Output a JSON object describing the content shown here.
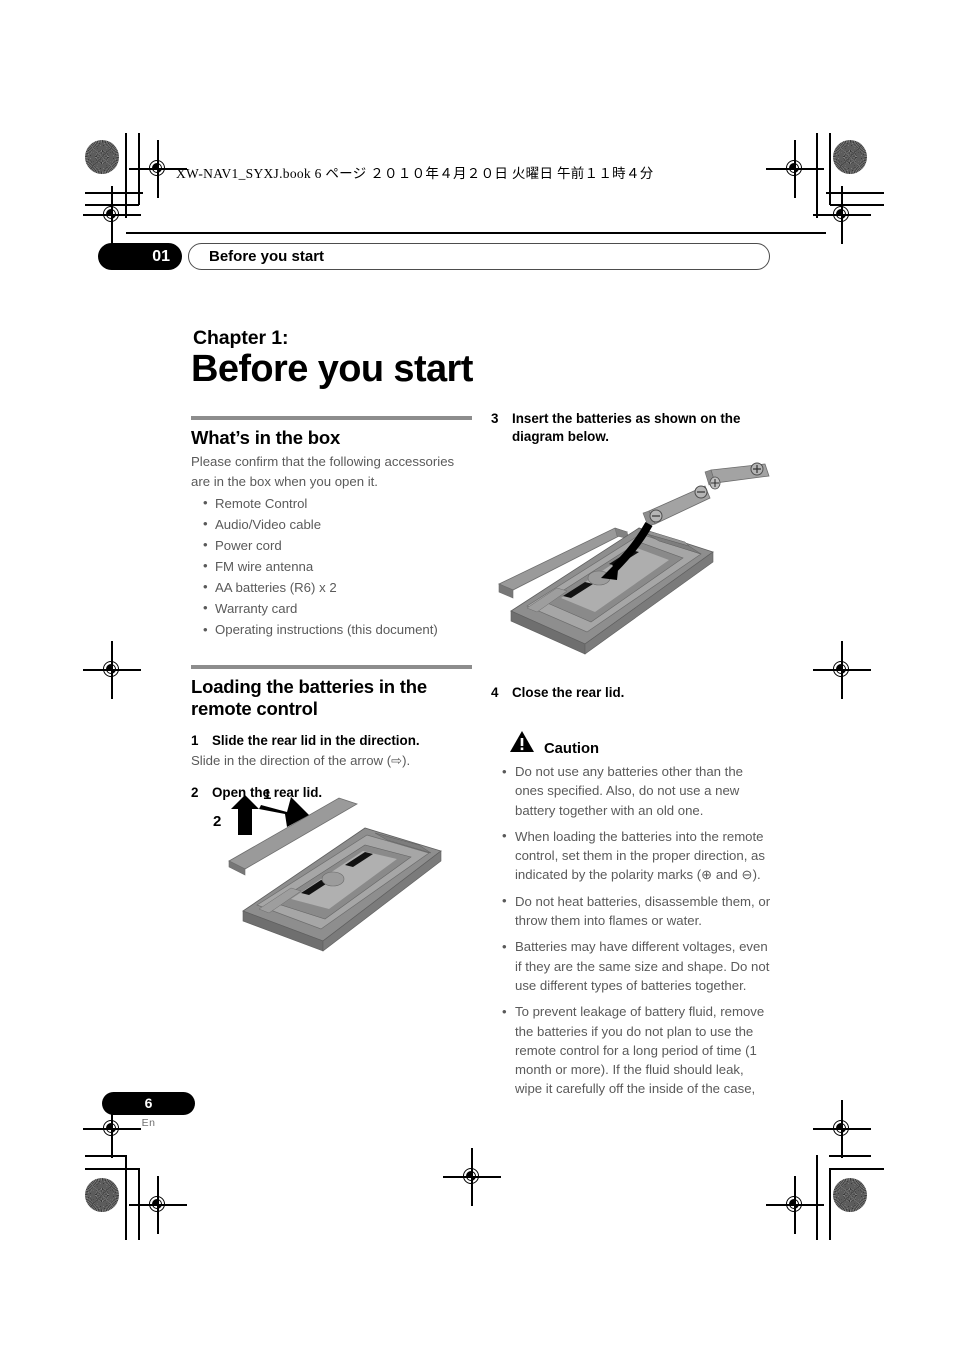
{
  "document": {
    "slug_line": "XW-NAV1_SYXJ.book   6 ページ   ２０１０年４月２０日   火曜日   午前１１時４分",
    "running_header": {
      "chapter_number": "01",
      "chapter_name": "Before you start"
    },
    "chapter_label": "Chapter 1:",
    "chapter_title": "Before you start",
    "footer": {
      "page_number": "6",
      "language": "En"
    },
    "colors": {
      "body_text": "#5a5a5a",
      "heading_text": "#000000",
      "rule": "#8d8d8d",
      "badge_background": "#000000",
      "badge_text": "#ffffff"
    }
  },
  "left_column": {
    "section_box": {
      "heading": "What’s in the box",
      "intro": "Please confirm that the following accessories are in the box when you open it.",
      "items": [
        "Remote Control",
        "Audio/Video cable",
        "Power cord",
        "FM wire antenna",
        "AA batteries (R6) x 2",
        "Warranty card",
        "Operating instructions (this document)"
      ]
    },
    "section_batteries": {
      "heading": "Loading the batteries in the remote control",
      "steps": [
        {
          "number": "1",
          "text": "Slide the rear lid in the direction.",
          "sub": "Slide in the direction of the arrow (⇨)."
        },
        {
          "number": "2",
          "text": "Open the rear lid.",
          "sub": ""
        }
      ]
    },
    "illustration": {
      "name": "remote-control-rear-lid-open",
      "labels": [
        "1",
        "2"
      ],
      "caption": ""
    }
  },
  "right_column": {
    "step3": {
      "number": "3",
      "text": "Insert the batteries as shown on the diagram below."
    },
    "illustration": {
      "name": "remote-control-battery-insert",
      "battery_polarity": [
        "+",
        "−"
      ]
    },
    "step4": {
      "number": "4",
      "text": "Close the rear lid."
    },
    "caution": {
      "title": "Caution",
      "icon": "warning-triangle-icon",
      "items": [
        "Do not use any batteries other than the ones specified. Also, do not use a new battery together with an old one.",
        "When loading the batteries into the remote control, set them in the proper direction, as indicated by the polarity marks (⊕ and ⊖).",
        "Do not heat batteries, disassemble them, or throw them into flames or water.",
        "Batteries may have different voltages, even if they are the same size and shape. Do not use different types of batteries together.",
        "To prevent leakage of battery fluid, remove the batteries if you do not plan to use the remote control for a long period of time (1 month or more). If the fluid should leak, wipe it carefully off the inside of the case,"
      ]
    }
  }
}
